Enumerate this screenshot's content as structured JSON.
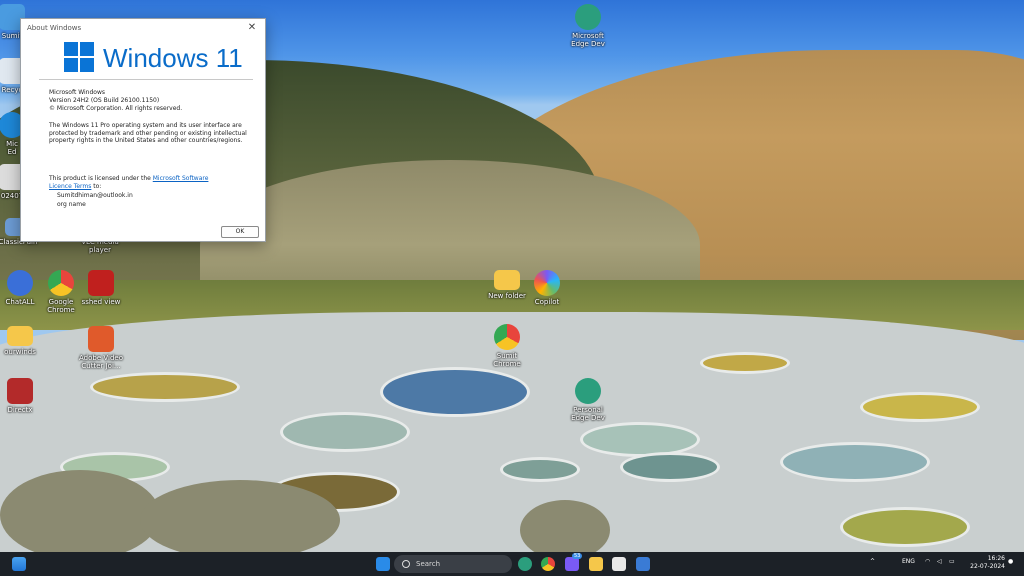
{
  "about_window": {
    "title": "About Windows",
    "logo_text": "Windows 11",
    "product": "Microsoft Windows",
    "version": "Version 24H2 (OS Build 26100.1150)",
    "copyright": "© Microsoft Corporation. All rights reserved.",
    "description": "The Windows 11 Pro operating system and its user interface are protected by trademark and other pending or existing intellectual property rights in the United States and other countries/regions.",
    "license_prefix": "This product is licensed under the ",
    "license_link": "Microsoft Software Licence Terms",
    "license_suffix": " to:",
    "user_email": "Sumitdhiman@outlook.in",
    "org_name": "org name",
    "ok_label": "OK"
  },
  "desktop_icons": [
    {
      "label": "Sumit",
      "icon": "folder-user-icon",
      "color": "#4a9be0"
    },
    {
      "label": "Recyc",
      "icon": "recycle-bin-icon",
      "color": "#e0e8f0"
    },
    {
      "label": "Mic\nEd",
      "icon": "edge-icon",
      "color": "#1e88d8"
    },
    {
      "label": "02407",
      "icon": "file-icon",
      "color": "#dcdcdc"
    },
    {
      "label": "ClassicPain",
      "icon": "paint-icon",
      "color": "#6c9bd3"
    },
    {
      "label": "VLC media\nplayer",
      "icon": "vlc-icon",
      "color": "#f28c1a"
    },
    {
      "label": "ChatALL",
      "icon": "chatall-icon",
      "color": "#3a6fd8"
    },
    {
      "label": "Google\nChrome",
      "icon": "chrome-icon",
      "color": "#e8453c"
    },
    {
      "label": "sshed view",
      "icon": "filezilla-icon",
      "color": "#c0201e"
    },
    {
      "label": "New folder",
      "icon": "folder-icon",
      "color": "#f5c74a"
    },
    {
      "label": "Copilot",
      "icon": "copilot-icon",
      "color": "#7a5af5"
    },
    {
      "label": "Microsoft\nEdge Dev",
      "icon": "edge-dev-icon",
      "color": "#2b9e7d"
    },
    {
      "label": "ourwinds",
      "icon": "folder-icon",
      "color": "#f5c74a"
    },
    {
      "label": "Adobe Video\nCutter Joi...",
      "icon": "video-cutter-icon",
      "color": "#e05a2b"
    },
    {
      "label": "Sumit\nChrome",
      "icon": "chrome-icon",
      "color": "#e8453c"
    },
    {
      "label": "Directx",
      "icon": "winrar-icon",
      "color": "#b32a2a"
    },
    {
      "label": "Personal\nEdge Dev",
      "icon": "edge-dev-icon",
      "color": "#2b9e7d"
    }
  ],
  "taskbar": {
    "search_placeholder": "Search",
    "badge_count": "53",
    "tray_lang": "ENG",
    "time": "16:26",
    "date": "22-07-2024"
  },
  "colors": {
    "accent": "#0a74d6",
    "taskbar": "#1c2127"
  }
}
